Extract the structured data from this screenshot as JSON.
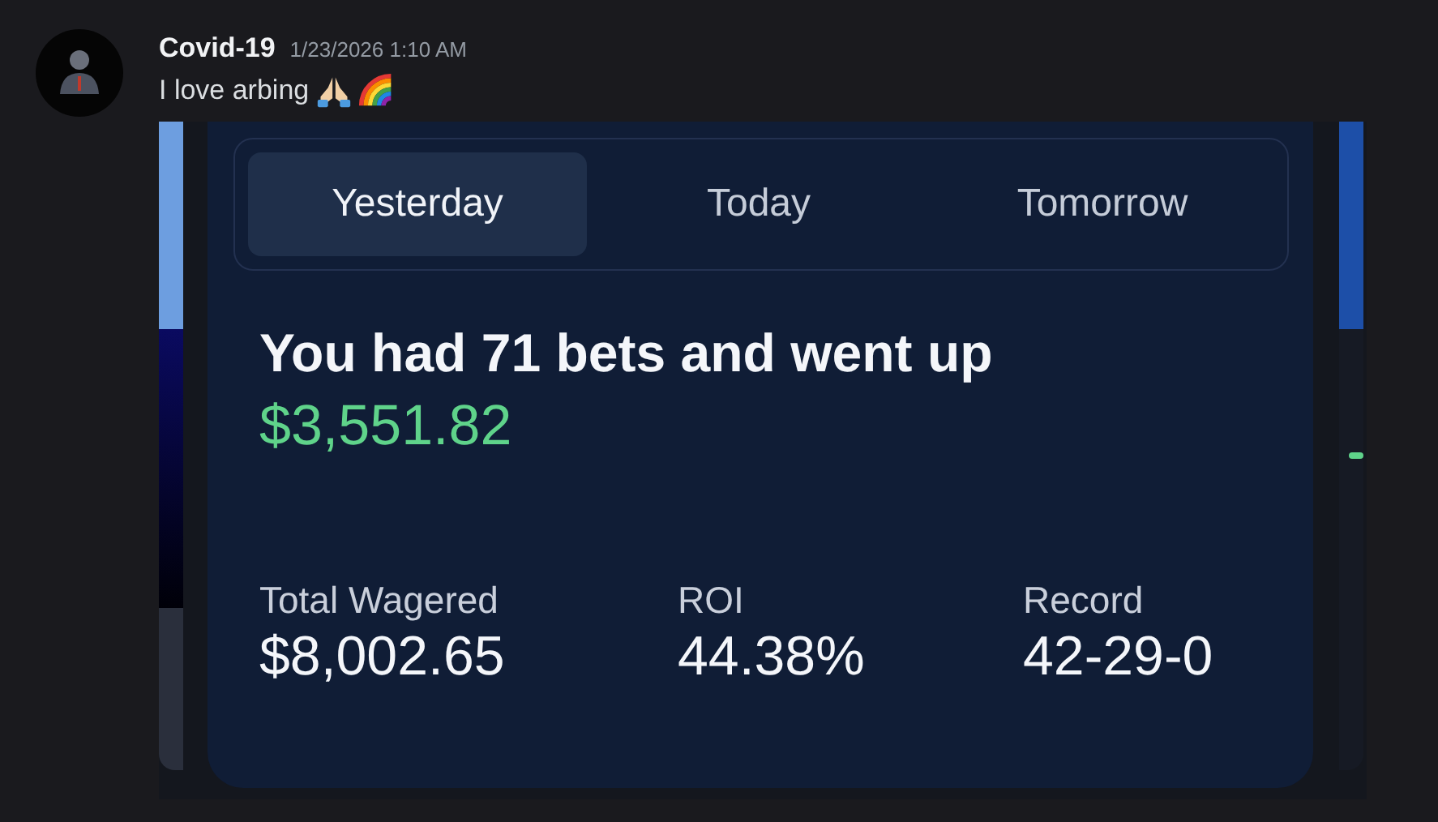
{
  "message": {
    "author": "Covid-19",
    "timestamp": "1/23/2026 1:10 AM",
    "text": "I love arbing"
  },
  "attachment": {
    "tabs": [
      {
        "label": "Yesterday",
        "selected": true
      },
      {
        "label": "Today",
        "selected": false
      },
      {
        "label": "Tomorrow",
        "selected": false
      }
    ],
    "headline": "You had 71 bets and went up",
    "amount": "$3,551.82",
    "stats": [
      {
        "label": "Total Wagered",
        "value": "$8,002.65"
      },
      {
        "label": "ROI",
        "value": "44.38%"
      },
      {
        "label": "Record",
        "value": "42-29-0"
      }
    ]
  }
}
